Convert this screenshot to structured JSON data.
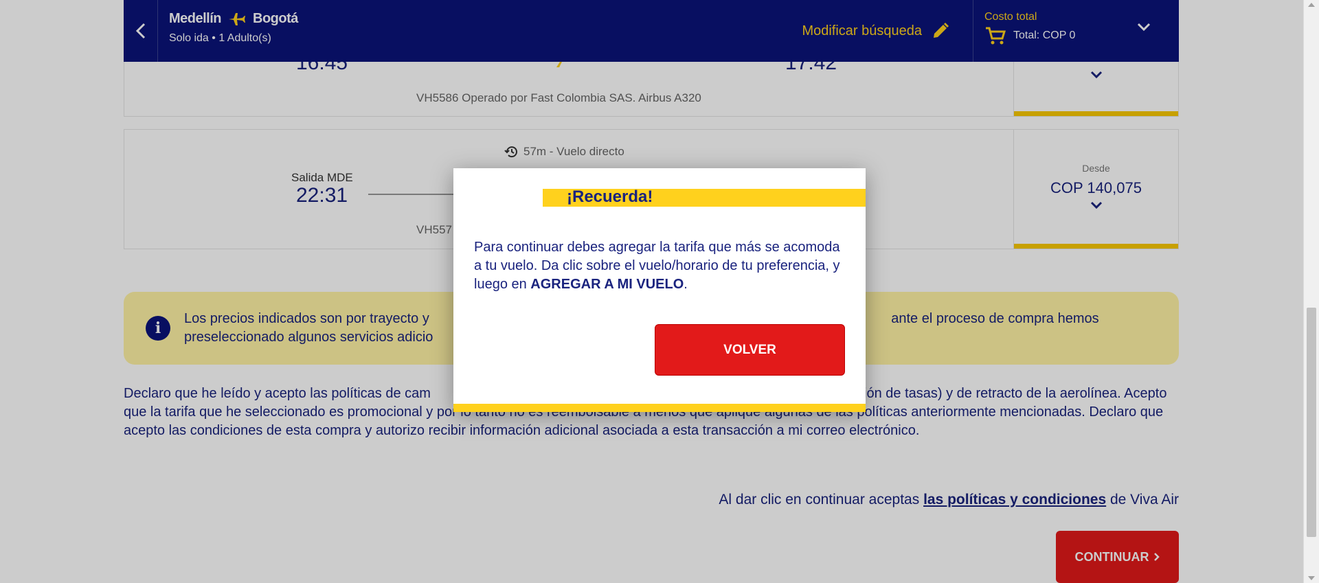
{
  "header": {
    "origin": "Medellín",
    "destination": "Bogotá",
    "trip_info": "Solo ida  •  1 Adulto(s)",
    "modify_label": "Modificar búsqueda",
    "cost_label": "Costo total",
    "cost_total": "Total: COP 0"
  },
  "flights": [
    {
      "depart_time": "16:45",
      "arrive_time": "17:42",
      "operator": "VH5586 Operado por Fast Colombia SAS. Airbus A320"
    },
    {
      "duration": "57m - Vuelo directo",
      "depart_label": "Salida MDE",
      "depart_time": "22:31",
      "operator_partial": "VH557",
      "price_label": "Desde",
      "price": "COP 140,075"
    }
  ],
  "info_banner": {
    "text": "Los precios indicados son por trayecto y                                                                                                                         ante el proceso de compra hemos preseleccionado algunos servicios adicio"
  },
  "declaration": "Declaro que he leído y acepto las políticas de cam                                                                                                         volución de tasas) y de retracto de la aerolínea. Acepto que la tarifa que he seleccionado es promocional y por lo tanto no es reembolsable a menos que aplique algunas de las políticas anteriormente mencionadas. Declaro que acepto las condiciones de esta compra y autorizo recibir información adicional asociada a esta transacción a mi correo electrónico.",
  "accept": {
    "prefix": "Al dar clic en continuar aceptas ",
    "link": "las políticas y condiciones",
    "suffix": " de Viva Air"
  },
  "continue_label": "CONTINUAR",
  "modal": {
    "title": "¡Recuerda!",
    "body_prefix": "Para continuar debes agregar la tarifa que más se acomoda a tu vuelo. Da clic sobre el vuelo/horario de tu preferencia, y luego en ",
    "body_bold": "AGREGAR A MI VUELO",
    "body_suffix": ".",
    "button_label": "VOLVER"
  },
  "colors": {
    "brand_navy": "#0a137a",
    "brand_yellow": "#ffd11d",
    "button_red": "#e21a1a"
  }
}
